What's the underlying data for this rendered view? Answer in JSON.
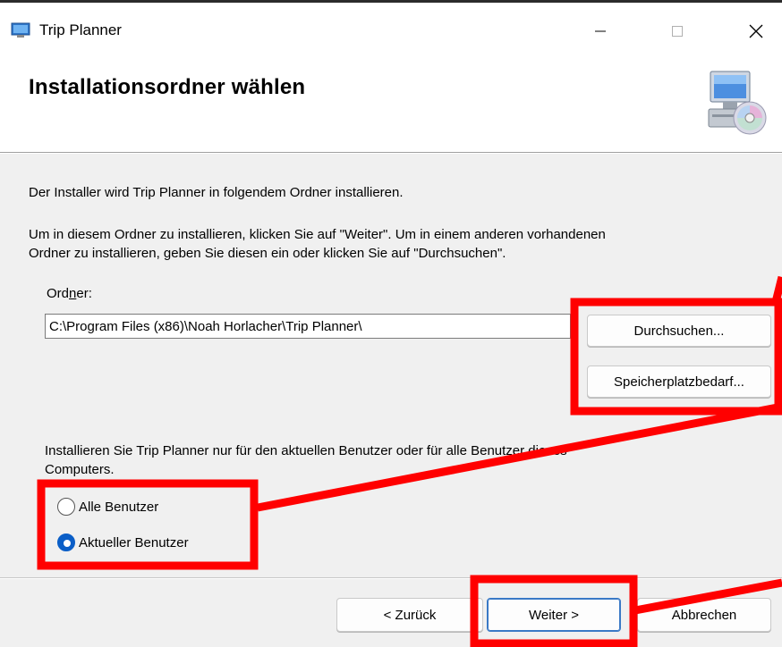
{
  "window": {
    "title": "Trip Planner",
    "controls": [
      "minimize",
      "maximize",
      "close"
    ]
  },
  "header": {
    "title": "Installationsordner wählen",
    "icon": "computer-disc-icon"
  },
  "body": {
    "intro": "Der Installer wird Trip Planner in folgendem Ordner installieren.",
    "instruction_line1": "Um in diesem Ordner zu installieren, klicken Sie auf \"Weiter\". Um in einem anderen vorhandenen",
    "instruction_line2": "Ordner zu installieren, geben Sie diesen ein oder klicken Sie auf \"Durchsuchen\"."
  },
  "folder": {
    "label_prefix": "Ord",
    "label_accel": "n",
    "label_suffix": "er:",
    "value": "C:\\Program Files (x86)\\Noah Horlacher\\Trip Planner\\"
  },
  "buttons": {
    "browse": "Durchsuchen...",
    "disk_cost": "Speicherplatzbedarf...",
    "back": "< Zurück",
    "next": "Weiter >",
    "cancel": "Abbrechen"
  },
  "scope": {
    "question_line1": "Installieren Sie Trip Planner nur für den aktuellen Benutzer oder für alle Benutzer dieses",
    "question_line2": "Computers.",
    "options": [
      {
        "label": "Alle Benutzer",
        "checked": false
      },
      {
        "label": "Aktueller Benutzer",
        "checked": true
      }
    ]
  },
  "colors": {
    "annotation": "#ff0000",
    "primary_border": "#3a79c6",
    "radio_selected": "#0a5ec7"
  }
}
